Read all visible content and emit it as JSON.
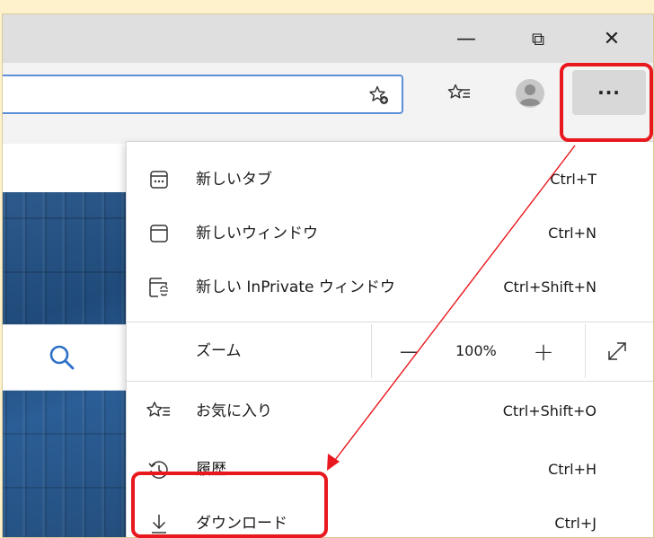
{
  "window": {
    "minimize_symbol": "—",
    "restore_symbol": "⧉",
    "close_symbol": "✕"
  },
  "toolbar": {
    "more_label": "···"
  },
  "menu": {
    "items": [
      {
        "label": "新しいタブ",
        "shortcut": "Ctrl+T",
        "icon": "new-tab-icon"
      },
      {
        "label": "新しいウィンドウ",
        "shortcut": "Ctrl+N",
        "icon": "new-window-icon"
      },
      {
        "label": "新しい InPrivate ウィンドウ",
        "shortcut": "Ctrl+Shift+N",
        "icon": "inprivate-icon"
      }
    ],
    "zoom": {
      "label": "ズーム",
      "value": "100%",
      "minus": "—",
      "plus": "+"
    },
    "items2": [
      {
        "label": "お気に入り",
        "shortcut": "Ctrl+Shift+O",
        "icon": "favorites-icon"
      },
      {
        "label": "履歴",
        "shortcut": "Ctrl+H",
        "icon": "history-icon"
      },
      {
        "label": "ダウンロード",
        "shortcut": "Ctrl+J",
        "icon": "download-icon"
      }
    ]
  },
  "colors": {
    "annotation": "#e8181e",
    "background": "#fdf2cc",
    "accent": "#5b8fd6"
  }
}
